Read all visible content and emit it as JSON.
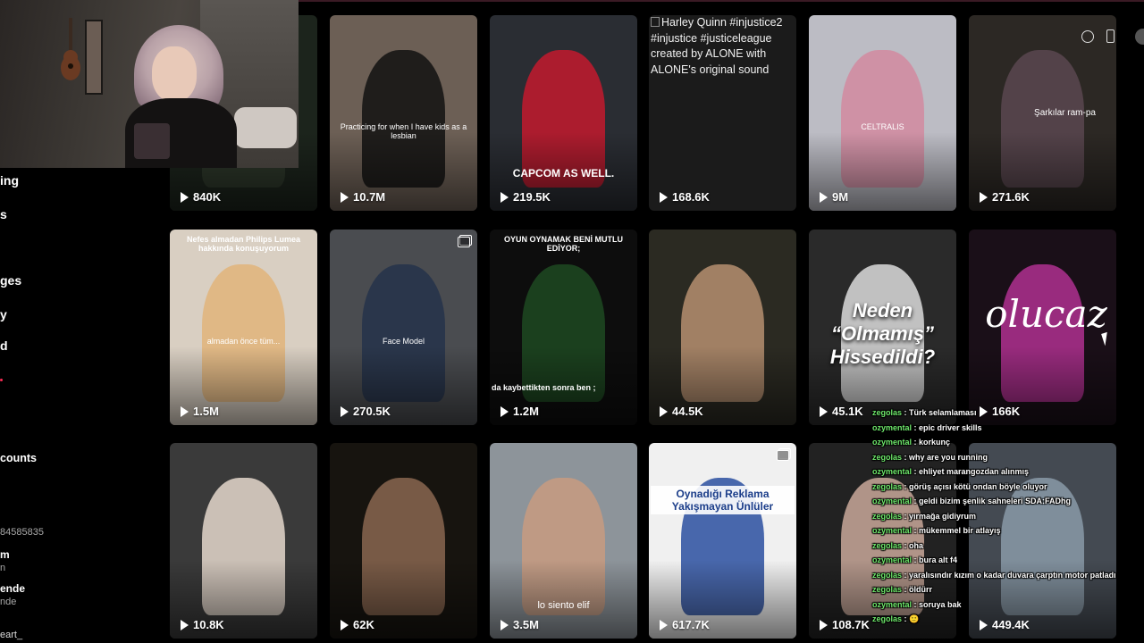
{
  "sidebar": {
    "items": [
      {
        "label": "ing"
      },
      {
        "label": "s"
      },
      {
        "label": "ges"
      },
      {
        "label": "y"
      },
      {
        "label": "d"
      },
      {
        "label": "counts"
      }
    ],
    "accounts": [
      {
        "name": "",
        "sub": "84585835"
      },
      {
        "name": "m",
        "sub": "n"
      },
      {
        "name": "ende",
        "sub": "nde"
      },
      {
        "name": "eart_",
        "sub": ""
      }
    ]
  },
  "videos": [
    {
      "views": "840K",
      "bg": "#1c241c",
      "accent": "#2f3a2c"
    },
    {
      "views": "10.7M",
      "bg": "#6c5f55",
      "accent": "#121212",
      "caption": "Practicing for when I have kids as a lesbian"
    },
    {
      "views": "219.5K",
      "bg": "#2a2d33",
      "accent": "#c31a2e",
      "caption": "CAPCOM AS WELL."
    },
    {
      "views": "168.6K",
      "bg": "#1b1b1b",
      "alt": "Harley Quinn #injustice2 #injustice #justiceleague created by ALONE with ALONE's original sound"
    },
    {
      "views": "9M",
      "bg": "#bcbcc4",
      "accent": "#d28aa0",
      "caption": "CELTRALIS"
    },
    {
      "views": "271.6K",
      "bg": "#2c2824",
      "accent": "#5a4750",
      "caption": "Şarkılar ram-pa"
    },
    {
      "views": "1.5M",
      "bg": "#d9cfc2",
      "accent": "#e0b47a",
      "top": "Nefes almadan Philips Lumea hakkında konuşuyorum",
      "caption": "almadan önce tüm..."
    },
    {
      "views": "270.5K",
      "bg": "#4a4c50",
      "accent": "#24324a",
      "caption": "Face Model"
    },
    {
      "views": "1.2M",
      "bg": "#0d0d0d",
      "accent": "#1f4a22",
      "top": "OYUN OYNAMAK BENİ MUTLU EDİYOR;",
      "caption": "da kaybettikten sonra ben ;"
    },
    {
      "views": "44.5K",
      "bg": "#2b2a22",
      "accent": "#b68f70"
    },
    {
      "views": "45.1K",
      "bg": "#2a2a2a",
      "accent": "#dcdcdc",
      "big": "Neden “Olmamış” Hissedildi?"
    },
    {
      "views": "166K",
      "bg": "#1a0f18",
      "accent": "#b03090",
      "big": "olucaz"
    },
    {
      "views": "10.8K",
      "bg": "#3a3a3a",
      "accent": "#e5d8cd"
    },
    {
      "views": "62K",
      "bg": "#17140f",
      "accent": "#8a6650"
    },
    {
      "views": "3.5M",
      "bg": "#8d949a",
      "accent": "#c89b80",
      "caption": "lo siento elif"
    },
    {
      "views": "617.7K",
      "bg": "#f0f0f0",
      "accent": "#2a4fa0",
      "big": "Oynadığı Reklama Yakışmayan Ünlüler"
    },
    {
      "views": "108.7K",
      "bg": "#222",
      "accent": "#c9a89a"
    },
    {
      "views": "449.4K",
      "bg": "#444a52",
      "accent": "#8a9aa8"
    }
  ],
  "chat": [
    {
      "user": "zegolas",
      "msg": "Türk selamlaması"
    },
    {
      "user": "ozymental",
      "msg": "epic driver skills"
    },
    {
      "user": "ozymental",
      "msg": "korkunç"
    },
    {
      "user": "zegolas",
      "msg": "why are you running"
    },
    {
      "user": "ozymental",
      "msg": "ehliyet marangozdan alınmış"
    },
    {
      "user": "zegolas",
      "msg": "görüş açısı kötü ondan böyle oluyor"
    },
    {
      "user": "ozymental",
      "msg": "geldi bizim şenlik sahneleri SDA:FADhg"
    },
    {
      "user": "zegolas",
      "msg": "yırmağa gidiyrum"
    },
    {
      "user": "ozymental",
      "msg": "mükemmel bir atlayış"
    },
    {
      "user": "zegolas",
      "msg": "oha"
    },
    {
      "user": "ozymental",
      "msg": "bura alt f4"
    },
    {
      "user": "zegolas",
      "msg": "yaralısındır kızım o kadar duvara çarptın motor patladı"
    },
    {
      "user": "zegolas",
      "msg": "öldürr"
    },
    {
      "user": "ozymental",
      "msg": "soruya bak"
    },
    {
      "user": "zegolas",
      "msg": "🙂"
    }
  ],
  "icons": {
    "play": "play-icon",
    "multi": "multi-image-icon",
    "compass": "compass-icon",
    "phone": "phone-icon",
    "cursor": "cursor-icon"
  },
  "colors": {
    "chat_user": "#6ee86b",
    "accent": "#fe2c55"
  }
}
